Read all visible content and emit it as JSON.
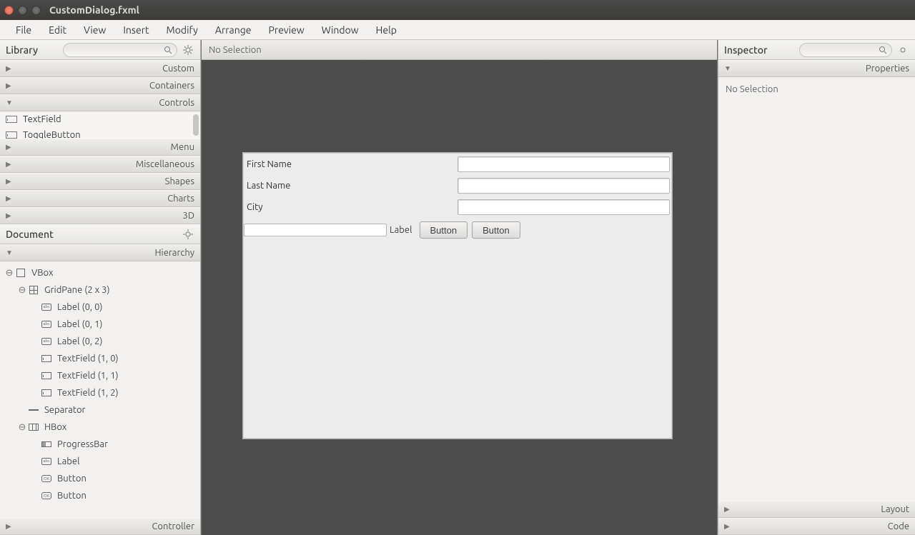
{
  "window": {
    "title": "CustomDialog.fxml"
  },
  "menubar": [
    "File",
    "Edit",
    "View",
    "Insert",
    "Modify",
    "Arrange",
    "Preview",
    "Window",
    "Help"
  ],
  "library": {
    "title": "Library",
    "sections": [
      {
        "label": "Custom",
        "open": false
      },
      {
        "label": "Containers",
        "open": false
      },
      {
        "label": "Controls",
        "open": true,
        "visibleItems": [
          "TextField",
          "ToggleButton"
        ]
      },
      {
        "label": "Menu",
        "open": false
      },
      {
        "label": "Miscellaneous",
        "open": false
      },
      {
        "label": "Shapes",
        "open": false
      },
      {
        "label": "Charts",
        "open": false
      },
      {
        "label": "3D",
        "open": false
      }
    ]
  },
  "document": {
    "title": "Document",
    "hierarchyLabel": "Hierarchy",
    "tree": [
      {
        "d": 0,
        "exp": "⊖",
        "icon": "box",
        "txt": "VBox"
      },
      {
        "d": 1,
        "exp": "⊖",
        "icon": "grid",
        "txt": "GridPane (2 x 3)"
      },
      {
        "d": 2,
        "exp": "",
        "icon": "abc",
        "txt": "Label (0, 0)"
      },
      {
        "d": 2,
        "exp": "",
        "icon": "abc",
        "txt": "Label (0, 1)"
      },
      {
        "d": 2,
        "exp": "",
        "icon": "abc",
        "txt": "Label (0, 2)"
      },
      {
        "d": 2,
        "exp": "",
        "icon": "tf",
        "txt": "TextField (1, 0)"
      },
      {
        "d": 2,
        "exp": "",
        "icon": "tf",
        "txt": "TextField (1, 1)"
      },
      {
        "d": 2,
        "exp": "",
        "icon": "tf",
        "txt": "TextField (1, 2)"
      },
      {
        "d": 1,
        "exp": "",
        "icon": "sep",
        "txt": "Separator"
      },
      {
        "d": 1,
        "exp": "⊖",
        "icon": "h",
        "txt": "HBox"
      },
      {
        "d": 2,
        "exp": "",
        "icon": "prog",
        "txt": "ProgressBar"
      },
      {
        "d": 2,
        "exp": "",
        "icon": "abc",
        "txt": "Label"
      },
      {
        "d": 2,
        "exp": "",
        "icon": "ok",
        "txt": "Button"
      },
      {
        "d": 2,
        "exp": "",
        "icon": "ok",
        "txt": "Button"
      }
    ],
    "controllerLabel": "Controller"
  },
  "canvas": {
    "selection": "No Selection",
    "form": {
      "rows": [
        {
          "label": "First Name"
        },
        {
          "label": "Last Name"
        },
        {
          "label": "City"
        }
      ],
      "hbox": {
        "label": "Label",
        "button1": "Button",
        "button2": "Button"
      }
    }
  },
  "inspector": {
    "title": "Inspector",
    "propertiesLabel": "Properties",
    "body": "No Selection",
    "layoutLabel": "Layout",
    "codeLabel": "Code"
  }
}
